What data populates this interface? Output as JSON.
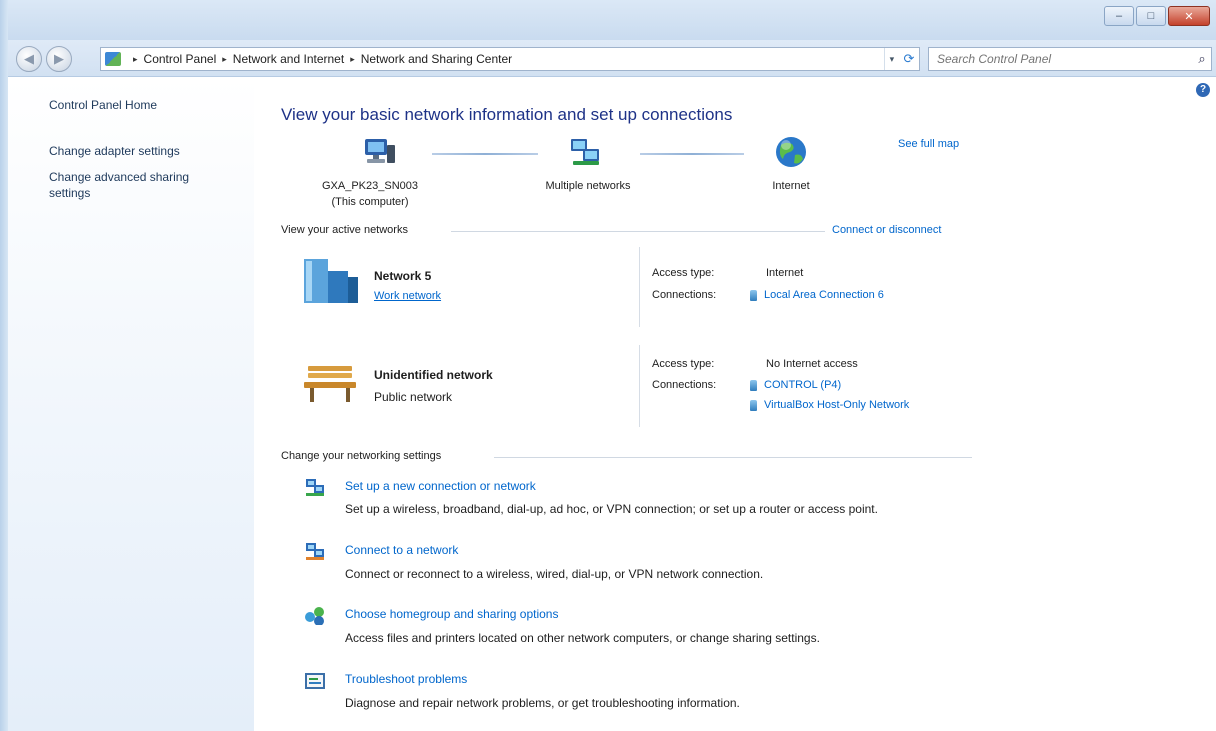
{
  "window": {
    "controls": {
      "minimize": "–",
      "maximize": "□",
      "close": "✕"
    }
  },
  "nav": {
    "back_glyph": "◀",
    "forward_glyph": "▶",
    "breadcrumb": [
      "Control Panel",
      "Network and Internet",
      "Network and Sharing Center"
    ],
    "breadcrumb_separator": "▸",
    "dropdown_glyph": "▾",
    "refresh_glyph": "⟳",
    "search_placeholder": "Search Control Panel",
    "search_glyph": "⌕"
  },
  "sidebar": {
    "home": "Control Panel Home",
    "links": [
      "Change adapter settings",
      "Change advanced sharing settings"
    ]
  },
  "help_glyph": "?",
  "main": {
    "heading": "View your basic network information and set up connections",
    "see_full_map": "See full map",
    "map": {
      "computer": {
        "name": "GXA_PK23_SN003",
        "sub": "(This computer)"
      },
      "networks": "Multiple networks",
      "internet": "Internet"
    },
    "active": {
      "title": "View your active networks",
      "connect_link": "Connect or disconnect",
      "networks": [
        {
          "name": "Network  5",
          "type": "Work network",
          "type_is_link": true,
          "access_label": "Access type:",
          "access_value": "Internet",
          "connections_label": "Connections:",
          "connections": [
            "Local Area Connection 6"
          ]
        },
        {
          "name": "Unidentified network",
          "type": "Public network",
          "type_is_link": false,
          "access_label": "Access type:",
          "access_value": "No Internet access",
          "connections_label": "Connections:",
          "connections": [
            "CONTROL (P4)",
            "VirtualBox Host-Only Network"
          ]
        }
      ]
    },
    "settings": {
      "title": "Change your networking settings",
      "tasks": [
        {
          "title": "Set up a new connection or network",
          "desc": "Set up a wireless, broadband, dial-up, ad hoc, or VPN connection; or set up a router or access point."
        },
        {
          "title": "Connect to a network",
          "desc": "Connect or reconnect to a wireless, wired, dial-up, or VPN network connection."
        },
        {
          "title": "Choose homegroup and sharing options",
          "desc": "Access files and printers located on other network computers, or change sharing settings."
        },
        {
          "title": "Troubleshoot problems",
          "desc": "Diagnose and repair network problems, or get troubleshooting information."
        }
      ]
    }
  },
  "colors": {
    "link": "#0066cc",
    "heading": "#1e3287",
    "sidebar_link": "#1e395b"
  }
}
